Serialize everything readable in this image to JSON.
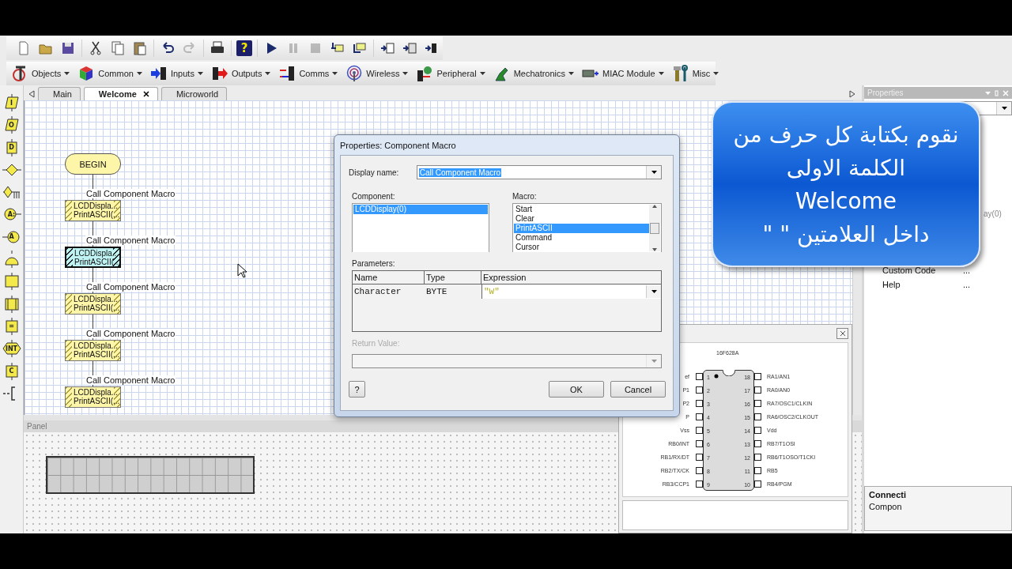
{
  "toolbar": [
    {
      "buttons": [
        {
          "kind": "new",
          "disabled": false
        },
        {
          "kind": "open",
          "disabled": false
        },
        {
          "kind": "save",
          "disabled": false
        }
      ]
    },
    {
      "buttons": [
        {
          "kind": "cut",
          "disabled": false
        },
        {
          "kind": "copy",
          "disabled": false
        },
        {
          "kind": "paste",
          "disabled": false
        }
      ]
    },
    {
      "buttons": [
        {
          "kind": "undo",
          "disabled": false
        },
        {
          "kind": "redo",
          "disabled": true
        }
      ]
    },
    {
      "buttons": [
        {
          "kind": "print",
          "disabled": false
        }
      ]
    },
    {
      "buttons": [
        {
          "kind": "help",
          "label": "?",
          "disabled": false
        }
      ]
    },
    {
      "buttons": [
        {
          "kind": "play",
          "disabled": false
        },
        {
          "kind": "pause",
          "disabled": true
        },
        {
          "kind": "stop",
          "disabled": true
        },
        {
          "kind": "step_into",
          "disabled": false
        },
        {
          "kind": "step_over",
          "disabled": false
        }
      ]
    },
    {
      "buttons": [
        {
          "kind": "compile_c",
          "disabled": false
        },
        {
          "kind": "compile_hex",
          "disabled": false
        },
        {
          "kind": "compile_chip",
          "disabled": false
        }
      ]
    }
  ],
  "component_groups": [
    {
      "kind": "objects",
      "label": "Objects"
    },
    {
      "kind": "common",
      "label": "Common"
    },
    {
      "kind": "inputs",
      "label": "Inputs"
    },
    {
      "kind": "outputs",
      "label": "Outputs"
    },
    {
      "kind": "comms",
      "label": "Comms"
    },
    {
      "kind": "wireless",
      "label": "Wireless"
    },
    {
      "kind": "peripheral",
      "label": "Peripheral"
    },
    {
      "kind": "mechatronics",
      "label": "Mechatronics"
    },
    {
      "kind": "miac",
      "label": "MIAC Module"
    },
    {
      "kind": "misc",
      "label": "Misc"
    }
  ],
  "palette": [
    {
      "kind": "input",
      "label": "I"
    },
    {
      "kind": "output",
      "label": "O"
    },
    {
      "kind": "delay",
      "label": "D"
    },
    {
      "kind": "decision"
    },
    {
      "kind": "switch"
    },
    {
      "kind": "connection_point",
      "label": "A:"
    },
    {
      "kind": "goto",
      "label": "A"
    },
    {
      "kind": "loop"
    },
    {
      "kind": "macro"
    },
    {
      "kind": "component_macro"
    },
    {
      "kind": "calculation",
      "label": "="
    },
    {
      "kind": "interrupt",
      "label": "INT"
    },
    {
      "kind": "code",
      "label": "C"
    },
    {
      "kind": "comment"
    }
  ],
  "tabs": [
    {
      "label": "Main",
      "selected": false,
      "closable": false
    },
    {
      "label": "Welcome",
      "selected": true,
      "closable": true
    },
    {
      "label": "Microworld",
      "selected": false,
      "closable": false
    }
  ],
  "flowchart": {
    "begin": "BEGIN",
    "blocks": [
      {
        "label": "Call Component Macro",
        "line1": "LCDDispla...",
        "line2": "PrintASCII(...",
        "selected": false
      },
      {
        "label": "Call Component Macro",
        "line1": "LCDDispla...",
        "line2": "PrintASCII(...",
        "selected": true
      },
      {
        "label": "Call Component Macro",
        "line1": "LCDDispla...",
        "line2": "PrintASCII(...",
        "selected": false
      },
      {
        "label": "Call Component Macro",
        "line1": "LCDDispla...",
        "line2": "PrintASCII(...",
        "selected": false
      },
      {
        "label": "Call Component Macro",
        "line1": "LCDDispla...",
        "line2": "PrintASCII(...",
        "selected": false
      }
    ]
  },
  "panel": {
    "title": "Panel"
  },
  "dialog": {
    "title": "Properties: Component Macro",
    "display_name": {
      "label": "Display name:",
      "value": "Call Component Macro",
      "selected": true
    },
    "component": {
      "label": "Component:",
      "items": [
        {
          "text": "LCDDisplay(0)",
          "selected": true
        }
      ]
    },
    "macro": {
      "label": "Macro:",
      "items": [
        {
          "text": "Start",
          "selected": false
        },
        {
          "text": "Clear",
          "selected": false
        },
        {
          "text": "PrintASCII",
          "selected": true
        },
        {
          "text": "Command",
          "selected": false
        },
        {
          "text": "Cursor",
          "selected": false
        }
      ]
    },
    "parameters": {
      "label": "Parameters:",
      "columns": [
        "Name",
        "Type",
        "Expression"
      ],
      "rows": [
        {
          "name": "Character",
          "type": "BYTE",
          "expression": "\"W\""
        }
      ]
    },
    "return_value": {
      "label": "Return Value:",
      "disabled": true
    },
    "buttons": {
      "help": "?",
      "ok": "OK",
      "cancel": "Cancel"
    }
  },
  "chip_window": {
    "chip": "16F628A",
    "pins_left": [
      {
        "number": "1",
        "label": "ef"
      },
      {
        "number": "2",
        "label": "P1"
      },
      {
        "number": "3",
        "label": "P2"
      },
      {
        "number": "4",
        "label": "P"
      },
      {
        "number": "5",
        "label": "Vss"
      },
      {
        "number": "6",
        "label": "RB0/INT"
      },
      {
        "number": "7",
        "label": "RB1/RX/DT"
      },
      {
        "number": "8",
        "label": "RB2/TX/CK"
      },
      {
        "number": "9",
        "label": "RB3/CCP1"
      }
    ],
    "pins_right": [
      {
        "number": "18",
        "label": "RA1/AN1"
      },
      {
        "number": "17",
        "label": "RA0/AN0"
      },
      {
        "number": "16",
        "label": "RA7/OSC1/CLKIN"
      },
      {
        "number": "15",
        "label": "RA6/OSC2/CLKOUT"
      },
      {
        "number": "14",
        "label": "Vdd"
      },
      {
        "number": "13",
        "label": "RB7/T1OSI"
      },
      {
        "number": "12",
        "label": "RB6/T1OSO/T1CKI"
      },
      {
        "number": "11",
        "label": "RB5"
      },
      {
        "number": "10",
        "label": "RB4/PGM"
      }
    ]
  },
  "properties": {
    "title": "Properties",
    "fragment": "ay(0)",
    "rows": [
      {
        "name": "Custom Code",
        "value": "..."
      },
      {
        "name": "Help",
        "value": "..."
      }
    ],
    "footer": {
      "title": "Connecti",
      "text": "Compon"
    }
  },
  "callout": {
    "lines": [
      "نقوم بكتابة كل حرف من",
      "الكلمة الاولى",
      "Welcome",
      "داخل العلامتين \" \""
    ]
  }
}
